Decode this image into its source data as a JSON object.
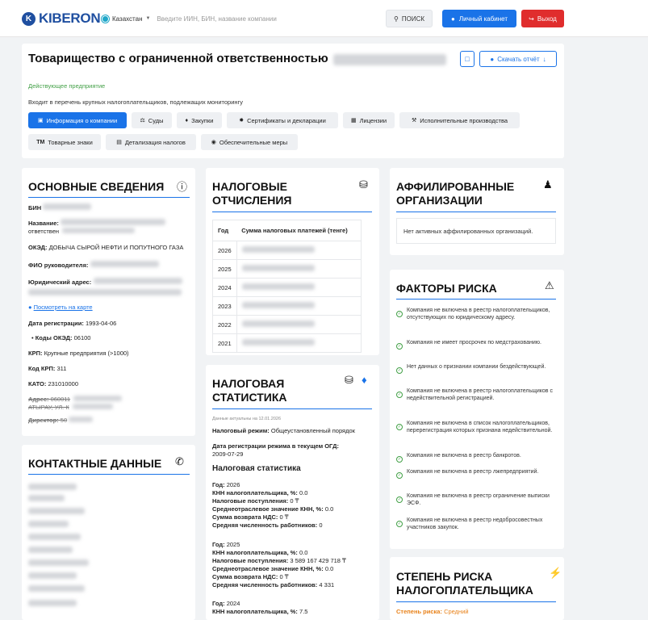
{
  "header": {
    "logo_text": "KIBERON",
    "country": "Казахстан",
    "search_placeholder": "Введите ИИН, БИН, название компании",
    "search_button": "ПОИСК",
    "cabinet_button": "Личный кабинет",
    "exit_button": "Выход"
  },
  "company": {
    "title": "Товарищество с ограниченной ответственностью",
    "download_button": "Скачать отчёт",
    "status": "Действующее предприятие",
    "note": "Входит в перечень крупных налогоплательщиков, подлежащих мониторингу"
  },
  "tabs": [
    "Информация о компании",
    "Суды",
    "Закупки",
    "Сертификаты и декларации",
    "Лицензии",
    "Исполнительные производства",
    "Товарные знаки",
    "Детализация налогов",
    "Обеспечительные меры"
  ],
  "basic": {
    "title": "ОСНОВНЫЕ СВЕДЕНИЯ",
    "bin_label": "БИН",
    "name_label": "Название:",
    "name_value": "ответствен",
    "oked_label": "ОКЭД:",
    "oked_value": "ДОБЫЧА СЫРОЙ НЕФТИ И ПОПУТНОГО ГАЗА",
    "head_label": "ФИО руководителя:",
    "address_label": "Юридический адрес:",
    "map_link": "Посмотреть на карте",
    "reg_label": "Дата регистрации:",
    "reg_value": "1993-04-06",
    "oked_codes_label": "Коды ОКЭД:",
    "oked_codes_value": "06100",
    "krp_label": "КРП:",
    "krp_value": "Крупные предприятия (>1000)",
    "krp_code_label": "Код КРП:",
    "krp_code_value": "311",
    "kato_label": "КАТО:",
    "kato_value": "231010000",
    "old_address_label": "Адрес:",
    "old_address_value": "060011",
    "old_address_line2": "АТЫРАУ, УЛ. К",
    "old_director_label": "Директор:",
    "old_director_value": "50"
  },
  "taxes": {
    "title_line1": "НАЛОГОВЫЕ",
    "title_line2": "ОТЧИСЛЕНИЯ",
    "col_year": "Год",
    "col_sum": "Сумма налоговых платежей (тенге)",
    "years": [
      "2026",
      "2025",
      "2024",
      "2023",
      "2022",
      "2021"
    ]
  },
  "affiliated": {
    "title_line1": "АФФИЛИРОВАННЫЕ",
    "title_line2": "ОРГАНИЗАЦИИ",
    "empty": "Нет активных аффилированных организаций."
  },
  "contacts": {
    "title": "КОНТАКТНЫЕ ДАННЫЕ"
  },
  "stats": {
    "title_line1": "НАЛОГОВАЯ",
    "title_line2": "СТАТИСТИКА",
    "actual": "Данные актуальны на 12.01.2026",
    "regime_label": "Налоговый режим:",
    "regime_value": "Общеустановленный порядок",
    "regime_date_label": "Дата регистрации режима в текущем ОГД:",
    "regime_date_value": "2009-07-29",
    "subtitle": "Налоговая статистика",
    "l_year": "Год:",
    "l_knn": "КНН налогоплательщика, %:",
    "l_income": "Налоговые поступления:",
    "l_avg": "Среднеотраслевое значение КНН, %:",
    "l_vat": "Сумма возврата НДС:",
    "l_staff": "Средняя численность работников:",
    "y2026": {
      "year": "2026",
      "knn": "0.0",
      "income": "0 ₸",
      "avg": "0.0",
      "vat": "0 ₸",
      "staff": "0"
    },
    "y2025": {
      "year": "2025",
      "knn": "0.0",
      "income": "3 589 167 429 718 ₸",
      "avg": "0.0",
      "vat": "0 ₸",
      "staff": "4 331"
    },
    "y2024": {
      "year": "2024",
      "knn": "7.5"
    }
  },
  "risks": {
    "title": "ФАКТОРЫ РИСКА",
    "items": [
      "Компания не включена в реестр налогоплательщиков, отсутствующих по юридическому адресу.",
      "Компания не имеет просрочек по медстрахованию.",
      "Нет данных о признании компании бездействующей.",
      "Компания не включена в реестр налогоплательщиков с недействительной регистрацией.",
      "Компания не включена в список налогоплательщиков, перерегистрация которых признана недействительной.",
      "Компания не включена в реестр банкротов.",
      "Компания не включена в реестр лжепредприятий.",
      "Компания не включена в реестр ограничение выписки ЭСФ.",
      "Компания не включена в реестр недобросовестных участников закупок."
    ]
  },
  "risk_degree": {
    "title_line1": "СТЕПЕНЬ РИСКА",
    "title_line2": "НАЛОГОПЛАТЕЛЬЩИКА",
    "label": "Степень риска:",
    "value": "Средний"
  }
}
